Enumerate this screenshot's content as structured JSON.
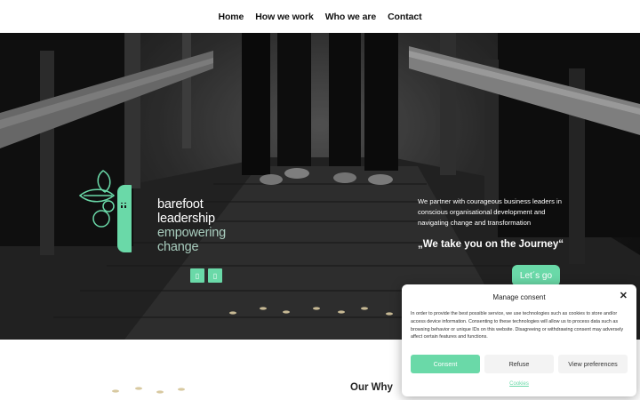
{
  "nav": {
    "items": [
      "Home",
      "How we work",
      "Who we are",
      "Contact"
    ]
  },
  "hero": {
    "brand": {
      "line1": "barefoot",
      "line2": "leadership",
      "line3": "empowering",
      "line4": "change"
    },
    "prev_icon": "▯",
    "next_icon": "▯",
    "text": "We partner with courageous business leaders in conscious organisational development and navigating change and transformation",
    "quote": "„We take you on the Journey“",
    "cta_label": "Let´s go"
  },
  "section": {
    "title": "Our Why"
  },
  "consent": {
    "title": "Manage consent",
    "close_icon": "✕",
    "body": "In order to provide the best possible service, we use technologies such as cookies to store and/or access device information. Consenting to these technologies will allow us to process data such as browsing behavior or unique IDs on this website. Disagreeing or withdrawing consent may adversely affect certain features and functions.",
    "accept_label": "Consent",
    "refuse_label": "Refuse",
    "prefs_label": "View preferences",
    "cookies_link": "Cookies"
  },
  "colors": {
    "accent": "#6ad9a8",
    "hero_dark": "#1a1a1a",
    "text_dark": "#111111"
  }
}
